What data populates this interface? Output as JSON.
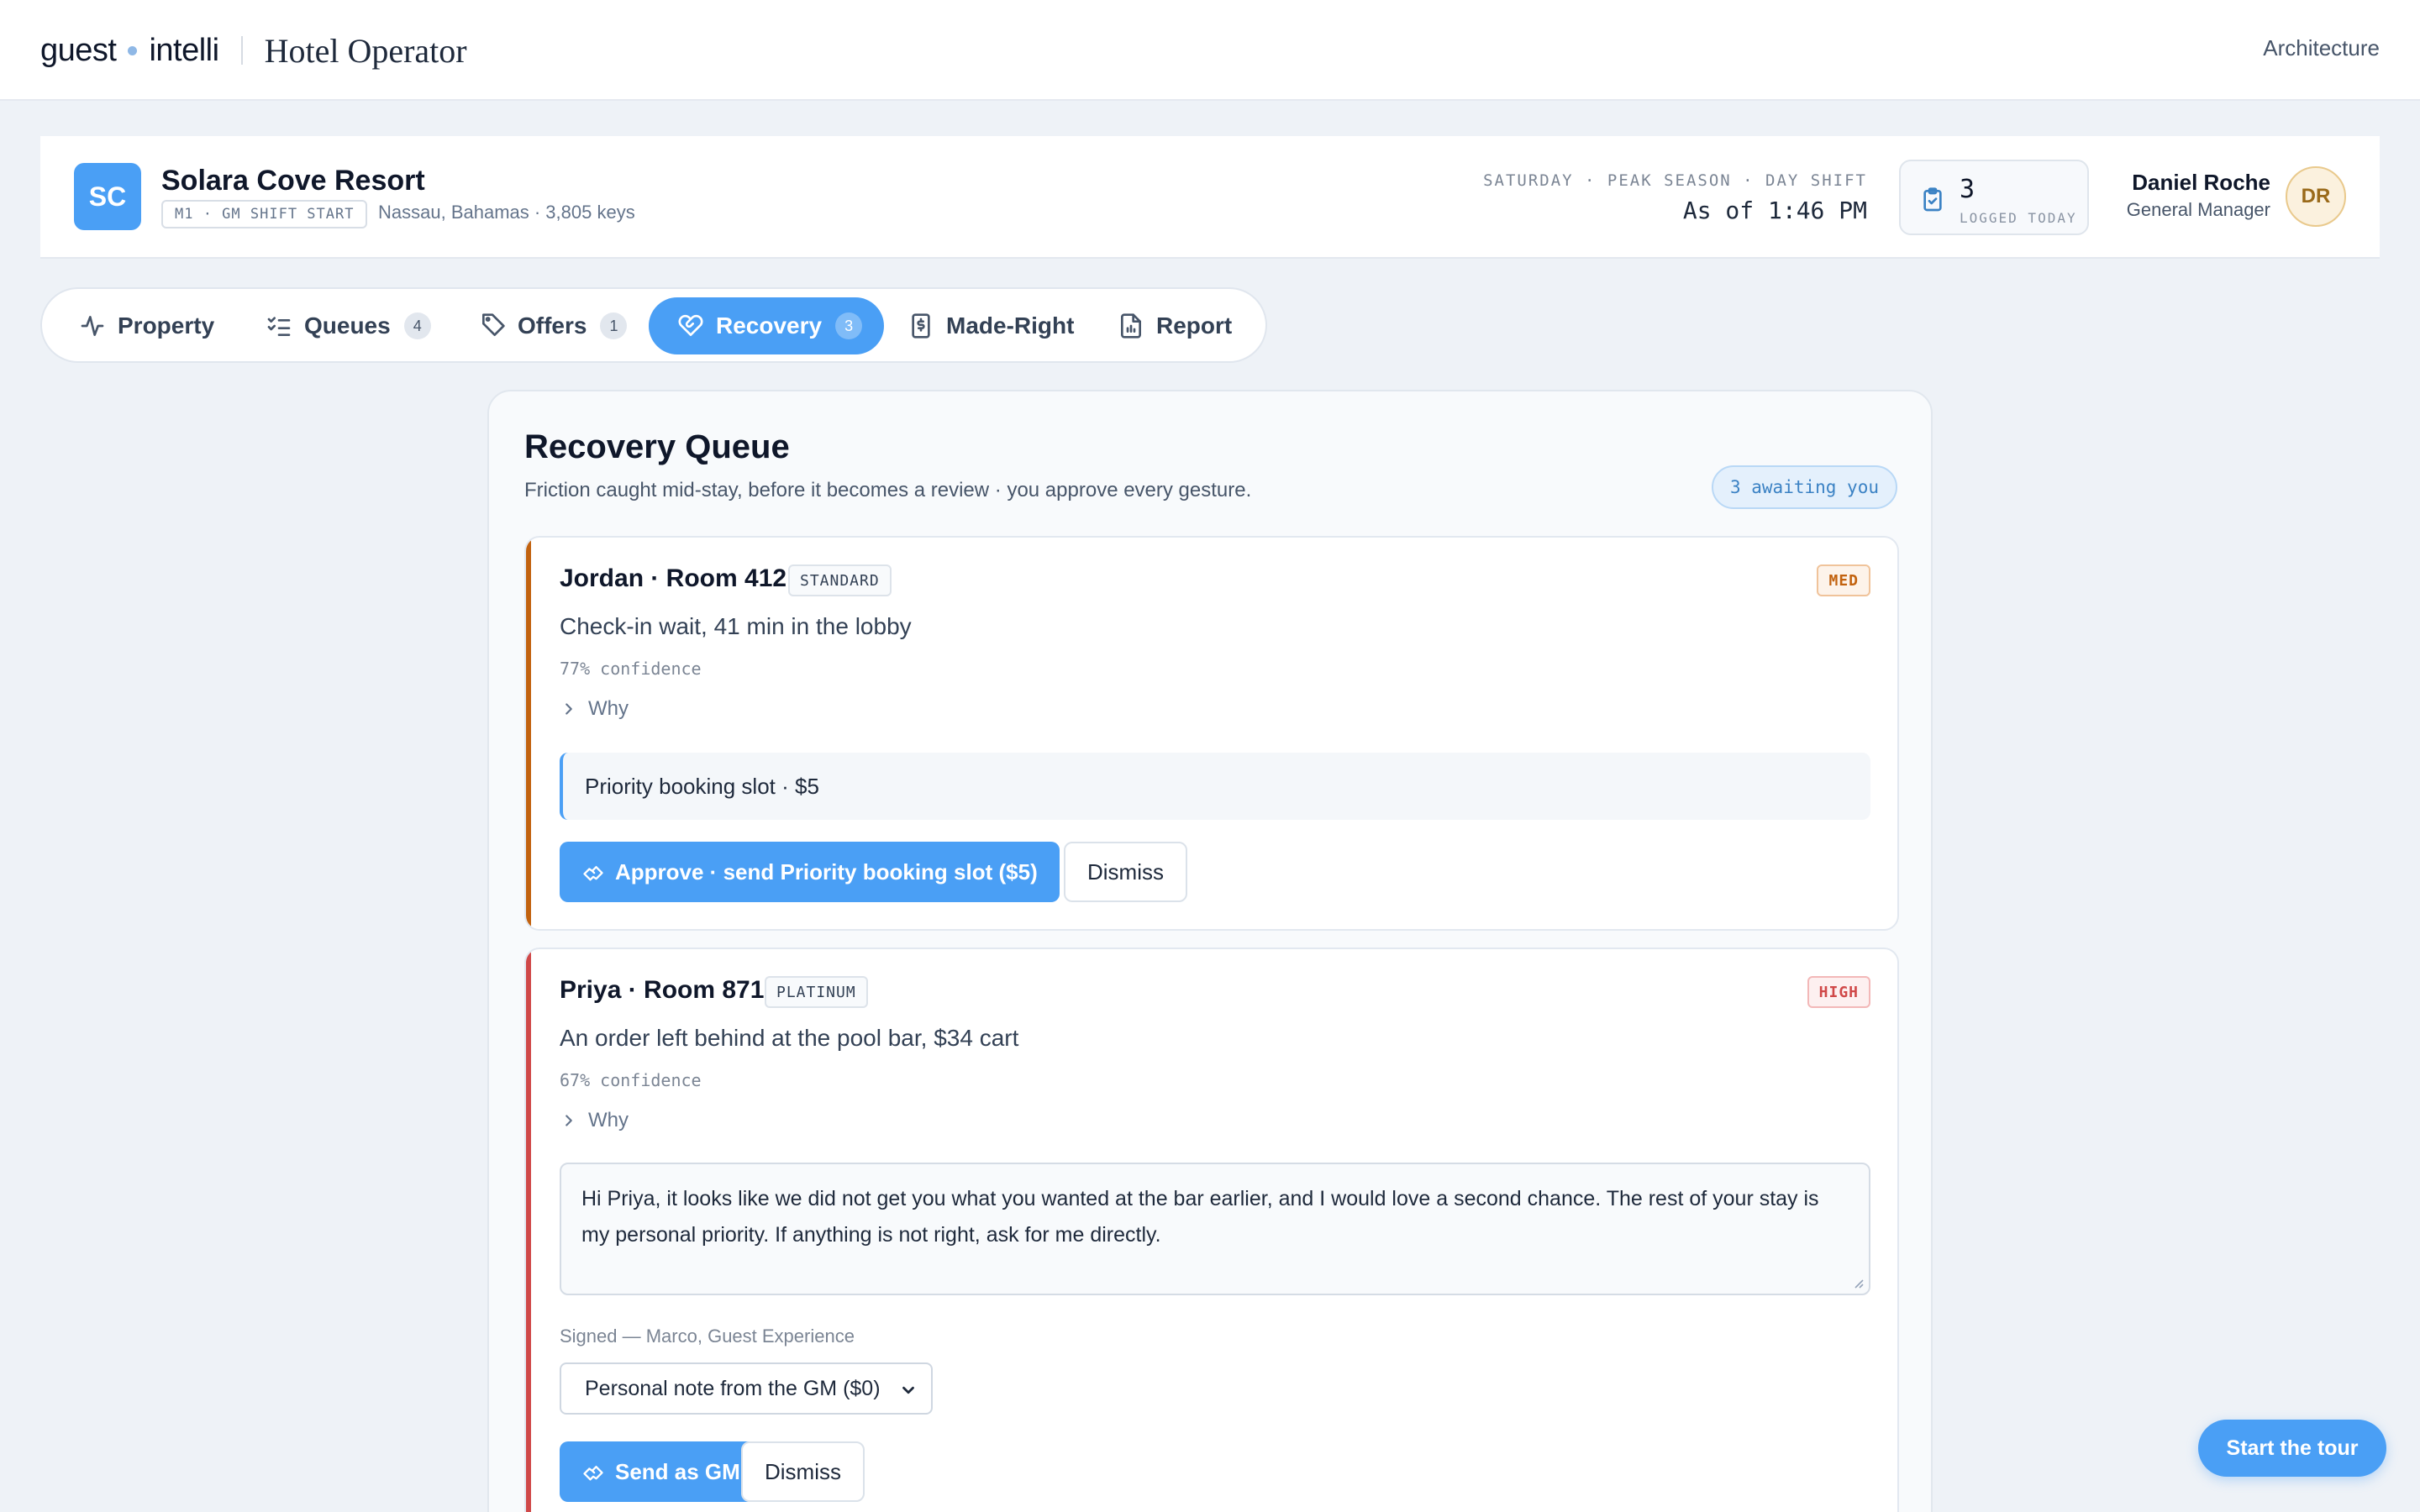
{
  "topbar": {
    "brand_left": "guest",
    "brand_right": "intelli",
    "app_name": "Hotel Operator",
    "nav_link": "Architecture"
  },
  "property": {
    "initials": "SC",
    "name": "Solara Cove Resort",
    "tag": "M1 · GM SHIFT START",
    "location": "Nassau, Bahamas · 3,805 keys",
    "shift": "SATURDAY · PEAK SEASON · DAY SHIFT",
    "as_of": "As of 1:46 PM",
    "logged_count": "3",
    "logged_label": "LOGGED TODAY",
    "user_name": "Daniel Roche",
    "user_role": "General Manager",
    "user_initials": "DR"
  },
  "tabs": [
    {
      "label": "Property",
      "icon": "pulse-icon"
    },
    {
      "label": "Queues",
      "count": "4",
      "icon": "checklist-icon"
    },
    {
      "label": "Offers",
      "count": "1",
      "icon": "tag-icon"
    },
    {
      "label": "Recovery",
      "count": "3",
      "icon": "heart-handshake-icon",
      "active": true
    },
    {
      "label": "Made-Right",
      "icon": "receipt-dollar-icon"
    },
    {
      "label": "Report",
      "icon": "file-chart-icon"
    }
  ],
  "recovery": {
    "title": "Recovery Queue",
    "subtitle": "Friction caught mid-stay, before it becomes a review · you approve every gesture.",
    "awaiting": "3 awaiting you",
    "cards": [
      {
        "guest": "Jordan · Room 412",
        "tier": "STANDARD",
        "severity": "MED",
        "severity_color": "#c2620f",
        "bar_color": "#c2620f",
        "issue": "Check-in wait, 41 min in the lobby",
        "confidence": "77% confidence",
        "why": "Why",
        "offer": "Priority booking slot · $5",
        "approve": "Approve · send Priority booking slot ($5)",
        "dismiss": "Dismiss"
      },
      {
        "guest": "Priya · Room 871",
        "tier": "PLATINUM",
        "severity": "HIGH",
        "severity_color": "#d04848",
        "bar_color": "#d04848",
        "issue": "An order left behind at the pool bar, $34 cart",
        "confidence": "67% confidence",
        "why": "Why",
        "note": "Hi Priya, it looks like we did not get you what you wanted at the bar earlier, and I would love a second chance. The rest of your stay is my personal priority. If anything is not right, ask for me directly.",
        "signed": "Signed — Marco, Guest Experience",
        "gesture_selected": "Personal note from the GM ($0)",
        "send": "Send as GM",
        "dismiss": "Dismiss"
      }
    ]
  },
  "tour_button": "Start the tour",
  "colors": {
    "accent": "#4a9ff5",
    "page_bg": "#eef2f7"
  }
}
